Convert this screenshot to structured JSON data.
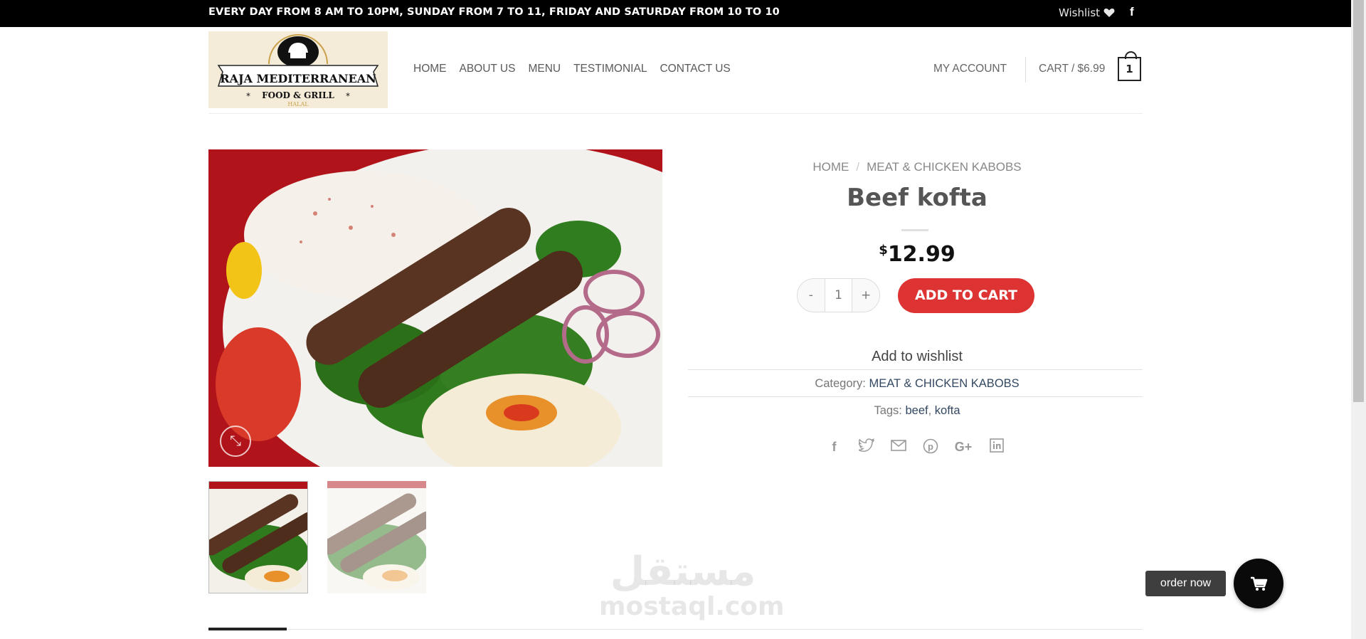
{
  "topbar": {
    "hours": "EVERY DAY FROM 8 AM TO 10PM, SUNDAY FROM 7 TO 11, FRIDAY AND SATURDAY FROM 10 TO 10",
    "wishlist": "Wishlist",
    "wishlist_icon": "heart-icon",
    "social_icon": "facebook-icon",
    "social_glyph": "f"
  },
  "logo": {
    "line1": "RAJA MEDITERRANEAN",
    "line2": "FOOD & GRILL",
    "line3": "HALAL"
  },
  "nav": {
    "items": [
      "HOME",
      "ABOUT US",
      "MENU",
      "TESTIMONIAL",
      "CONTACT US"
    ],
    "account": "MY ACCOUNT",
    "cart_label": "CART / $6.99",
    "cart_count": "1"
  },
  "product": {
    "breadcrumb": [
      "HOME",
      "MEAT & CHICKEN KABOBS"
    ],
    "title": "Beef kofta",
    "price_currency": "$",
    "price_value": "12.99",
    "qty_minus": "-",
    "qty_value": "1",
    "qty_plus": "+",
    "add_to_cart": "ADD TO CART",
    "add_to_wishlist": "Add to wishlist",
    "category_label": "Category:",
    "category_value": "MEAT & CHICKEN KABOBS",
    "tags_label": "Tags:",
    "tags": [
      "beef",
      "kofta"
    ],
    "share_icons": [
      "facebook-icon",
      "twitter-icon",
      "email-icon",
      "pinterest-icon",
      "google-plus-icon",
      "linkedin-icon"
    ]
  },
  "watermark": {
    "arabic": "مستقل",
    "latin": "mostaql.com"
  },
  "floating": {
    "order_now": "order now",
    "cart_icon": "shopping-cart-icon"
  },
  "colors": {
    "topbar_bg": "#000000",
    "accent_red": "#dd3333",
    "link_blue": "#334862"
  }
}
